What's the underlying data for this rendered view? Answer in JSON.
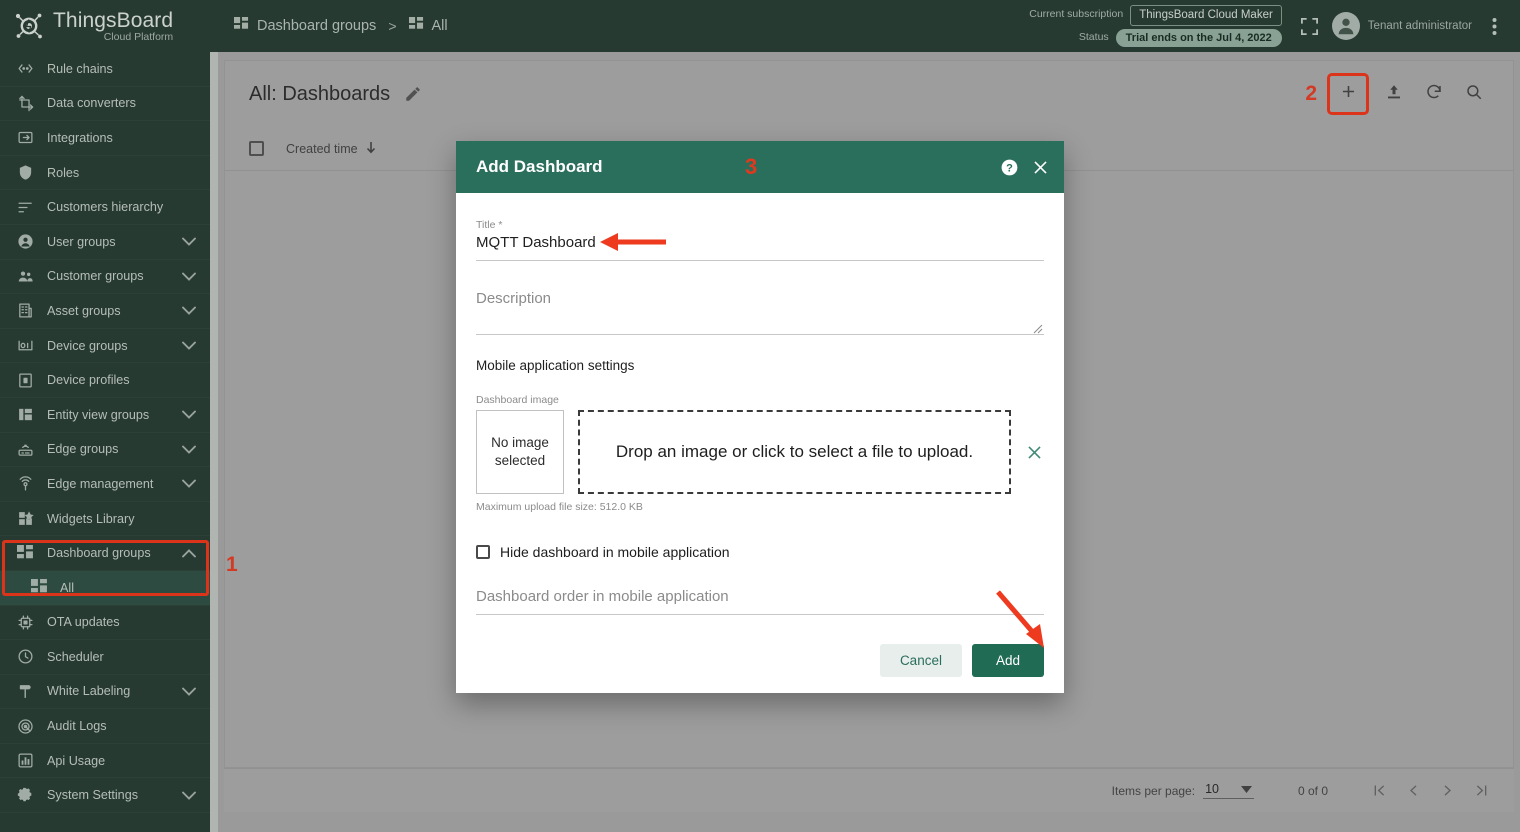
{
  "brand": {
    "title": "ThingsBoard",
    "subtitle": "Cloud Platform",
    "logo_icon": "thingsboard-logo-icon"
  },
  "sidebar": {
    "items": [
      {
        "label": "Rule chains",
        "icon": "rule-chains-icon",
        "expandable": false
      },
      {
        "label": "Data converters",
        "icon": "data-converters-icon",
        "expandable": false
      },
      {
        "label": "Integrations",
        "icon": "integrations-icon",
        "expandable": false
      },
      {
        "label": "Roles",
        "icon": "roles-shield-icon",
        "expandable": false
      },
      {
        "label": "Customers hierarchy",
        "icon": "customers-hierarchy-icon",
        "expandable": false
      },
      {
        "label": "User groups",
        "icon": "user-groups-icon",
        "expandable": true
      },
      {
        "label": "Customer groups",
        "icon": "customer-groups-icon",
        "expandable": true
      },
      {
        "label": "Asset groups",
        "icon": "asset-groups-icon",
        "expandable": true
      },
      {
        "label": "Device groups",
        "icon": "device-groups-icon",
        "expandable": true
      },
      {
        "label": "Device profiles",
        "icon": "device-profiles-icon",
        "expandable": false
      },
      {
        "label": "Entity view groups",
        "icon": "entity-view-groups-icon",
        "expandable": true
      },
      {
        "label": "Edge groups",
        "icon": "edge-groups-icon",
        "expandable": true
      },
      {
        "label": "Edge management",
        "icon": "edge-management-icon",
        "expandable": true
      },
      {
        "label": "Widgets Library",
        "icon": "widgets-library-icon",
        "expandable": false
      },
      {
        "label": "Dashboard groups",
        "icon": "dashboard-groups-icon",
        "expandable": true,
        "expanded": true
      },
      {
        "label": "All",
        "icon": "dashboard-groups-icon",
        "sub": true,
        "selected": true
      },
      {
        "label": "OTA updates",
        "icon": "ota-updates-icon",
        "expandable": false
      },
      {
        "label": "Scheduler",
        "icon": "scheduler-clock-icon",
        "expandable": false
      },
      {
        "label": "White Labeling",
        "icon": "white-labeling-icon",
        "expandable": true
      },
      {
        "label": "Audit Logs",
        "icon": "audit-logs-icon",
        "expandable": false
      },
      {
        "label": "Api Usage",
        "icon": "api-usage-icon",
        "expandable": false
      },
      {
        "label": "System Settings",
        "icon": "system-settings-gear-icon",
        "expandable": true
      }
    ]
  },
  "topbar": {
    "breadcrumb": [
      {
        "label": "Dashboard groups",
        "icon": "dashboard-groups-icon"
      },
      {
        "label": "All",
        "icon": "dashboard-groups-icon"
      }
    ],
    "breadcrumb_separator": ">",
    "subscription_label": "Current subscription",
    "subscription_value": "ThingsBoard Cloud Maker",
    "status_label": "Status",
    "status_value": "Trial ends on the Jul 4, 2022",
    "fullscreen_icon": "fullscreen-icon",
    "avatar_icon": "user-avatar-icon",
    "user_role": "Tenant administrator",
    "more_icon": "more-vertical-icon"
  },
  "page": {
    "title": "All: Dashboards",
    "edit_icon": "pencil-edit-icon",
    "annotation_2": "2",
    "add_icon": "plus-icon",
    "import_icon": "upload-import-icon",
    "refresh_icon": "refresh-icon",
    "search_icon": "search-icon",
    "columns": [
      {
        "label": "Created time",
        "sort_icon": "sort-arrow-down-icon"
      }
    ],
    "annotation_1": "1"
  },
  "footer": {
    "items_per_page_label": "Items per page:",
    "items_per_page_value": "10",
    "dropdown_icon": "chevron-down-icon",
    "range_label": "0 of 0",
    "first_page_icon": "first-page-icon",
    "prev_page_icon": "prev-page-icon",
    "next_page_icon": "next-page-icon",
    "last_page_icon": "last-page-icon"
  },
  "dialog": {
    "title": "Add Dashboard",
    "annotation_3": "3",
    "help_icon": "help-circle-icon",
    "close_icon": "close-icon",
    "title_field": {
      "label": "Title *",
      "value": "MQTT Dashboard"
    },
    "description_field": {
      "label": "Description",
      "placeholder": "Description",
      "value": ""
    },
    "mobile_section_title": "Mobile application settings",
    "dashboard_image": {
      "label": "Dashboard image",
      "no_image_text": "No image\nselected",
      "dropzone_text": "Drop an image or click to select a file to upload.",
      "clear_icon": "close-icon",
      "max_size_text": "Maximum upload file size: 512.0 KB"
    },
    "hide_checkbox_label": "Hide dashboard in mobile application",
    "hide_checkbox_checked": false,
    "order_field": {
      "label": "Dashboard order in mobile application",
      "placeholder": "Dashboard order in mobile application",
      "value": ""
    },
    "cancel_label": "Cancel",
    "add_label": "Add"
  },
  "colors": {
    "brand_green": "#2c4338",
    "dialog_green": "#2a6e5c",
    "accent_add": "#1f6b54",
    "annotation_red": "#f0432a",
    "selected_item": "#35564a"
  }
}
